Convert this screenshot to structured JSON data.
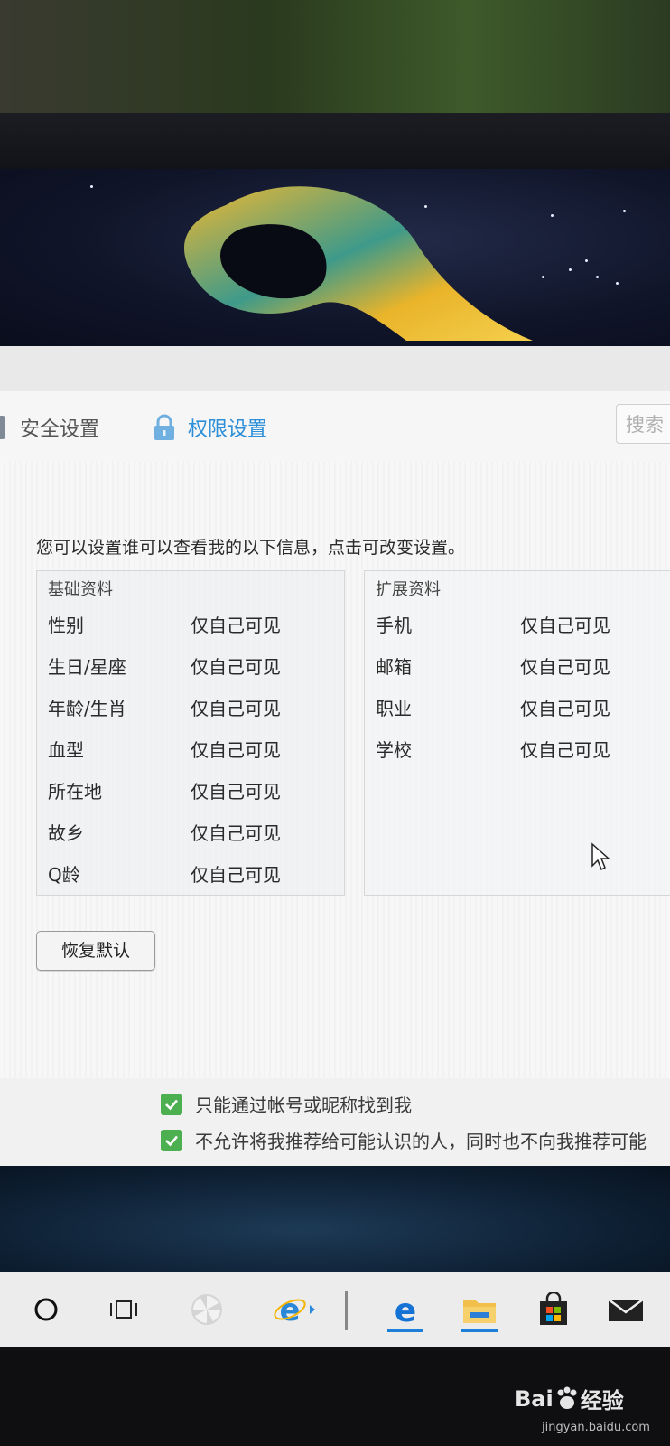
{
  "nav": {
    "tab_security": "安全设置",
    "tab_privacy": "权限设置",
    "search_placeholder": "搜索"
  },
  "content": {
    "intro": "您可以设置谁可以查看我的以下信息，点击可改变设置。",
    "basic": {
      "title": "基础资料",
      "rows": [
        {
          "label": "性别",
          "value": "仅自己可见"
        },
        {
          "label": "生日/星座",
          "value": "仅自己可见"
        },
        {
          "label": "年龄/生肖",
          "value": "仅自己可见"
        },
        {
          "label": "血型",
          "value": "仅自己可见"
        },
        {
          "label": "所在地",
          "value": "仅自己可见"
        },
        {
          "label": "故乡",
          "value": "仅自己可见"
        },
        {
          "label": "Q龄",
          "value": "仅自己可见"
        }
      ]
    },
    "extended": {
      "title": "扩展资料",
      "rows": [
        {
          "label": "手机",
          "value": "仅自己可见"
        },
        {
          "label": "邮箱",
          "value": "仅自己可见"
        },
        {
          "label": "职业",
          "value": "仅自己可见"
        },
        {
          "label": "学校",
          "value": "仅自己可见"
        }
      ]
    },
    "restore_button": "恢复默认"
  },
  "options": [
    {
      "label": "只能通过帐号或昵称找到我",
      "checked": true
    },
    {
      "label": "不允许将我推荐给可能认识的人，同时也不向我推荐可能",
      "checked": true
    }
  ],
  "watermark": {
    "brand": "Bai",
    "brand2": "经验",
    "url": "jingyan.baidu.com"
  },
  "colors": {
    "accent": "#2c8fd8",
    "check": "#4caf50",
    "taskbar": "#ececec"
  }
}
